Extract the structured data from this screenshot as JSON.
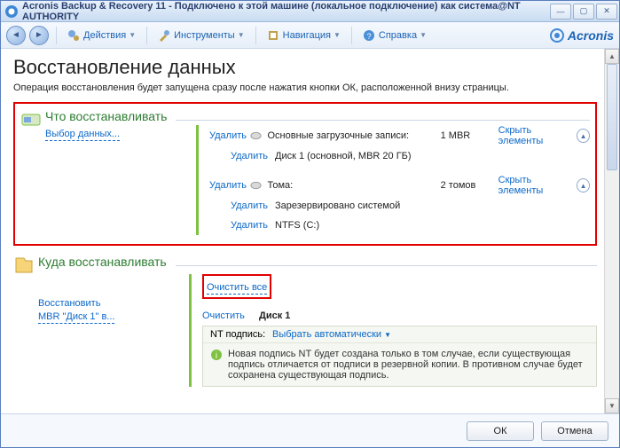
{
  "titlebar": {
    "title": "Acronis Backup & Recovery 11 - Подключено к этой машине (локальное подключение) как система@NT AUTHORITY"
  },
  "toolbar": {
    "actions": "Действия",
    "tools": "Инструменты",
    "navigation": "Навигация",
    "help": "Справка",
    "brand": "Acronis"
  },
  "page": {
    "heading": "Восстановление данных",
    "subtitle": "Операция восстановления будет запущена сразу после нажатия кнопки ОК, расположенной внизу страницы."
  },
  "what": {
    "title": "Что восстанавливать",
    "choose_data": "Выбор данных...",
    "delete": "Удалить",
    "mbr_label": "Основные загрузочные записи:",
    "mbr_val": "1 MBR",
    "disk1": "Диск 1 (основной, MBR 20 ГБ)",
    "volumes_label": "Тома:",
    "volumes_val": "2 томов",
    "sys_reserved": "Зарезервировано системой",
    "ntfs_c": "NTFS (C:)",
    "hide_elems": "Скрыть элементы"
  },
  "where": {
    "title": "Куда восстанавливать",
    "restore_mbr_line1": "Восстановить",
    "restore_mbr_line2": "MBR \"Диск 1\" в...",
    "clear_all": "Очистить все",
    "clear": "Очистить",
    "disk1": "Диск 1",
    "nt_sign_label": "NT подпись:",
    "nt_sign_val": "Выбрать автоматически",
    "info": "Новая подпись NT будет создана только в том случае, если существующая подпись отличается от подписи в резервной копии. В противном случае будет сохранена существующая подпись."
  },
  "footer": {
    "ok": "ОК",
    "cancel": "Отмена"
  }
}
